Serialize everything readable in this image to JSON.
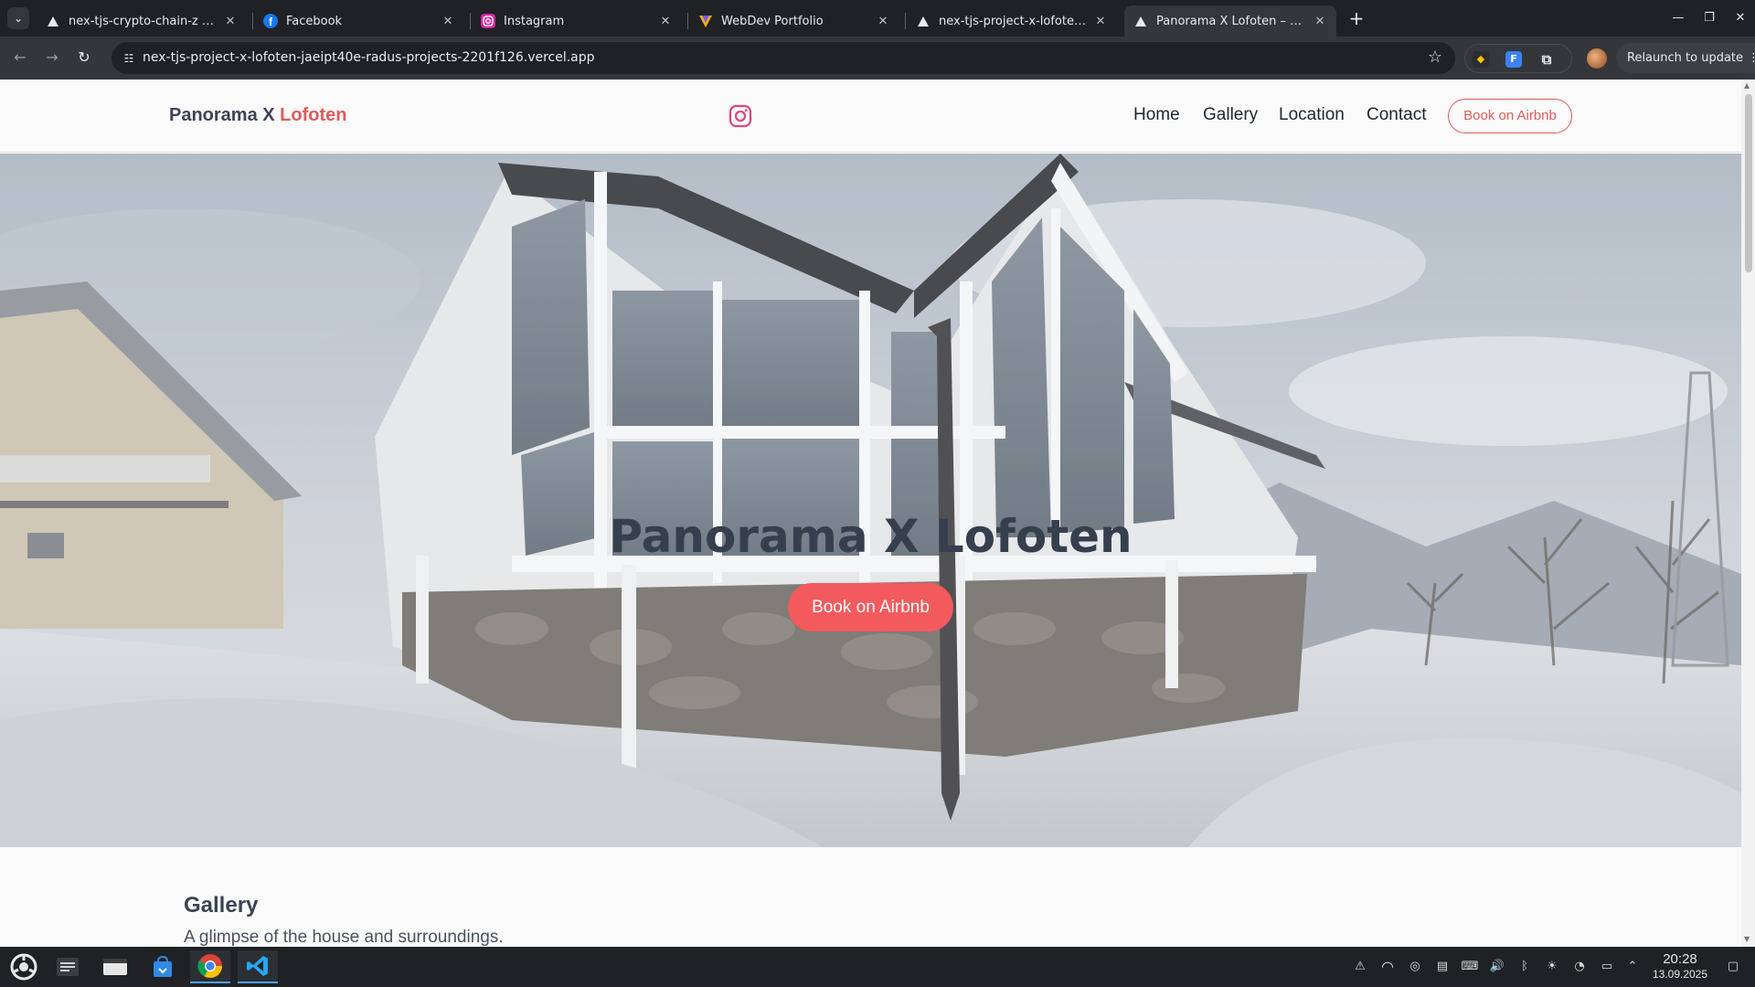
{
  "browser": {
    "tabs": [
      {
        "title": "nex-tjs-crypto-chain-z – Dep",
        "favicon": "vercel-icon",
        "active": false
      },
      {
        "title": "Facebook",
        "favicon": "facebook-icon",
        "active": false
      },
      {
        "title": "Instagram",
        "favicon": "instagram-icon",
        "active": false
      },
      {
        "title": "WebDev Portfolio",
        "favicon": "webdev-portfolio-icon",
        "active": false
      },
      {
        "title": "nex-tjs-project-x-lofoten – D",
        "favicon": "vercel-icon",
        "active": false
      },
      {
        "title": "Panorama X Lofoten – Seas",
        "favicon": "vercel-icon",
        "active": true
      }
    ],
    "new_tab": "+",
    "url": "nex-tjs-project-x-lofoten-jaeipt40e-radus-projects-2201f126.vercel.app",
    "relaunch_label": "Relaunch to update"
  },
  "site": {
    "brand_part1": "Panorama X",
    "brand_part2": "Lofoten",
    "nav": {
      "home": "Home",
      "gallery": "Gallery",
      "location": "Location",
      "contact": "Contact"
    },
    "header_cta": "Book on Airbnb",
    "hero": {
      "title": "Panorama X Lofoten",
      "cta": "Book on Airbnb"
    },
    "gallery": {
      "title": "Gallery",
      "subtitle": "A glimpse of the house and surroundings."
    },
    "colors": {
      "accent": "#f25a5e",
      "brand_dark": "#3d4555"
    }
  },
  "taskbar": {
    "apps": [
      "app-launcher-icon",
      "system-settings-icon",
      "file-manager-icon",
      "software-store-icon",
      "chrome-icon",
      "vscode-icon"
    ],
    "time": "20:28",
    "date": "13.09.2025"
  }
}
